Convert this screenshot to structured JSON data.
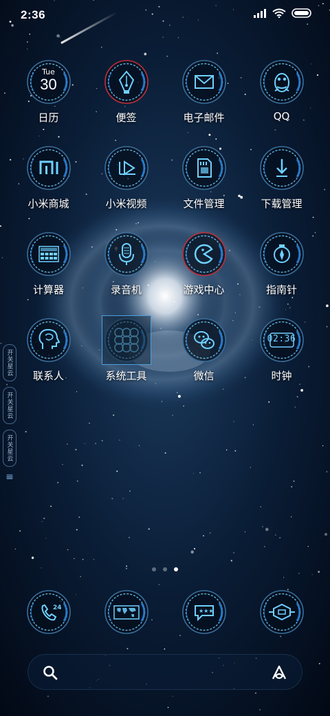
{
  "status_bar": {
    "time": "2:36",
    "icons": [
      "signal-icon",
      "wifi-icon",
      "battery-icon"
    ]
  },
  "edge_widget": {
    "tabs": [
      "开关星云",
      "开关星云",
      "开关星云"
    ],
    "menu_icon": "menu-lines-icon"
  },
  "apps": [
    {
      "label": "日历",
      "icon": "calendar-icon",
      "day": "Tue",
      "date": "30"
    },
    {
      "label": "便签",
      "icon": "pen-nib-icon"
    },
    {
      "label": "电子邮件",
      "icon": "envelope-icon"
    },
    {
      "label": "QQ",
      "icon": "penguin-icon"
    },
    {
      "label": "小米商城",
      "icon": "mi-logo-icon"
    },
    {
      "label": "小米视频",
      "icon": "video-play-icon"
    },
    {
      "label": "文件管理",
      "icon": "sd-card-icon"
    },
    {
      "label": "下载管理",
      "icon": "download-arrow-icon"
    },
    {
      "label": "计算器",
      "icon": "calculator-icon"
    },
    {
      "label": "录音机",
      "icon": "microphone-icon"
    },
    {
      "label": "游戏中心",
      "icon": "pacman-icon"
    },
    {
      "label": "指南针",
      "icon": "compass-icon"
    },
    {
      "label": "联系人",
      "icon": "head-profile-icon"
    },
    {
      "label": "系统工具",
      "icon": "folder-icon"
    },
    {
      "label": "微信",
      "icon": "wechat-icon"
    },
    {
      "label": "时钟",
      "icon": "digital-clock-icon",
      "clock_text": "02:36"
    }
  ],
  "page_indicator": {
    "count": 3,
    "active": 3
  },
  "dock": [
    {
      "icon": "phone-24-icon"
    },
    {
      "icon": "world-map-icon"
    },
    {
      "icon": "chat-bubble-icon"
    },
    {
      "icon": "hexagon-badge-icon"
    }
  ],
  "search_bar": {
    "search_icon": "search-icon",
    "assistant_icon": "assistant-icon"
  },
  "colors": {
    "ring": "#2a7fd4",
    "glow": "#6fd0ff",
    "accent_red": "#c0303a",
    "background": "#020814"
  }
}
